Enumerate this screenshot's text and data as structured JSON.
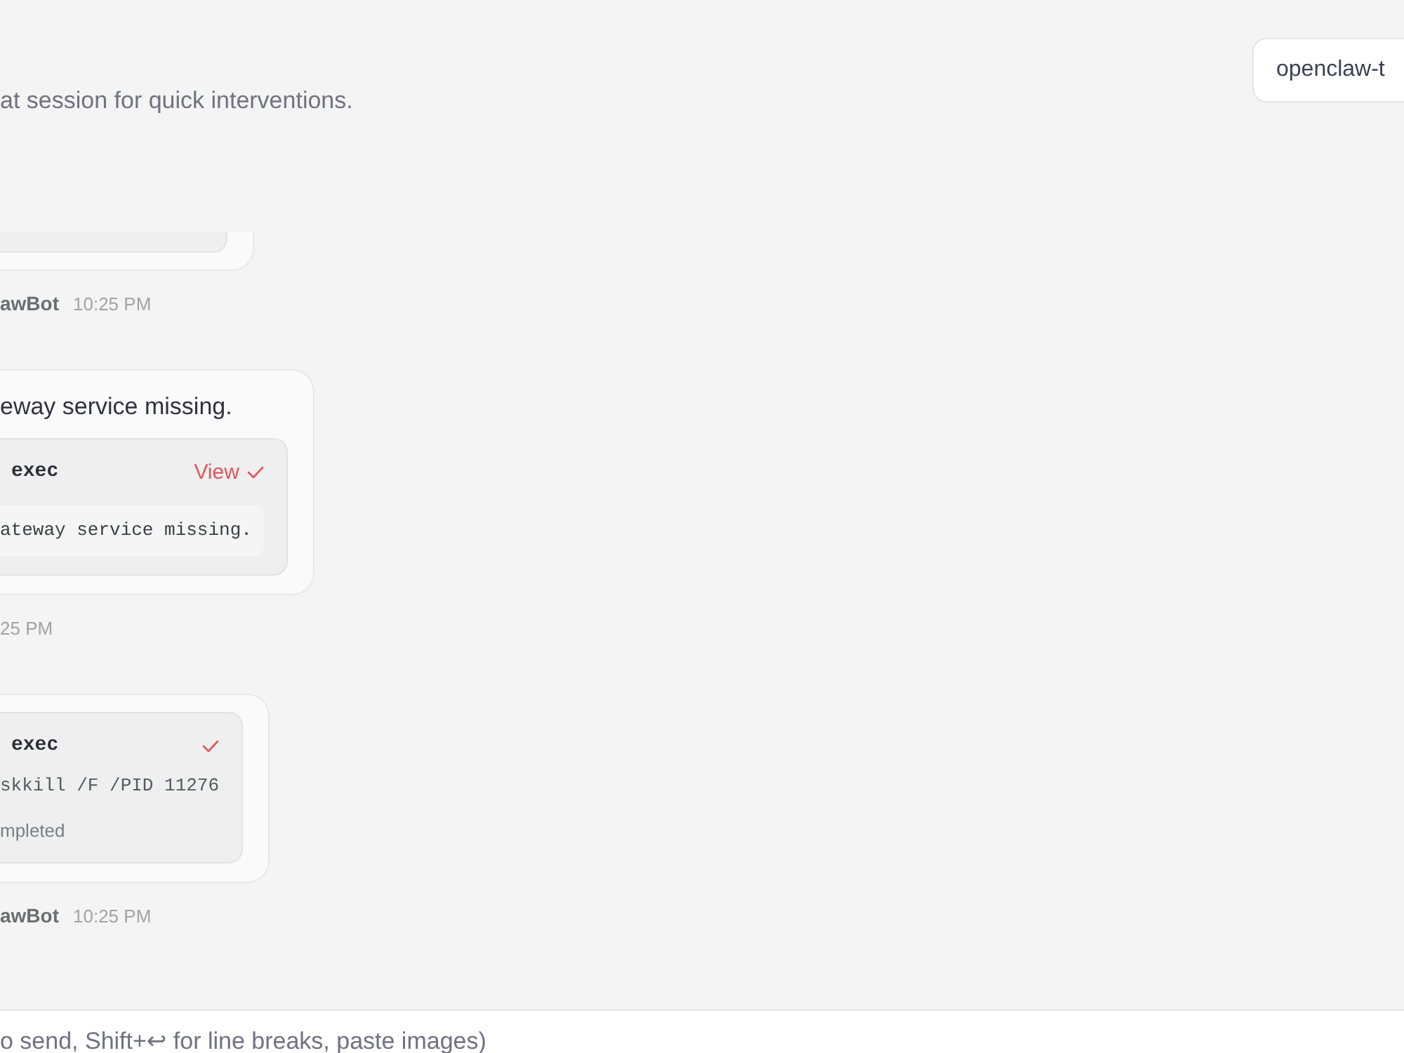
{
  "header": {
    "subtitle": "at session for quick interventions.",
    "session_select": {
      "value": "openclaw-t"
    }
  },
  "messages": [
    {
      "kind": "clipped",
      "meta": {
        "sender": "awBot",
        "time": "10:25 PM"
      }
    },
    {
      "kind": "full",
      "text": "eway service missing.",
      "tools": [
        {
          "name": "exec",
          "action": "View",
          "done": true,
          "output": "ateway service missing."
        }
      ],
      "meta": {
        "time": "25 PM"
      }
    },
    {
      "kind": "full",
      "tools": [
        {
          "name": "exec",
          "done": true,
          "command": "skkill /F /PID 11276",
          "result": "mpleted"
        }
      ],
      "meta": {
        "sender": "awBot",
        "time": "10:25 PM"
      }
    }
  ],
  "composer": {
    "placeholder": "o send, Shift+↩ for line breaks, paste images)"
  }
}
